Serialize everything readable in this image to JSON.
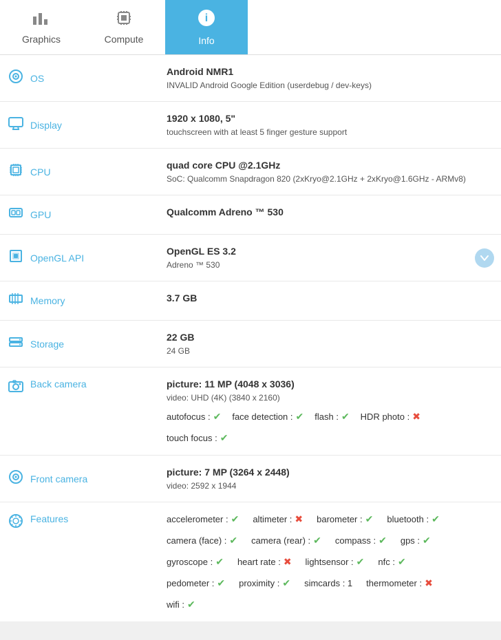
{
  "tabs": [
    {
      "id": "graphics",
      "label": "Graphics",
      "icon": "bar-chart",
      "active": false
    },
    {
      "id": "compute",
      "label": "Compute",
      "icon": "cpu-chip",
      "active": false
    },
    {
      "id": "info",
      "label": "Info",
      "icon": "info-circle",
      "active": true
    }
  ],
  "rows": [
    {
      "id": "os",
      "label": "OS",
      "icon": "os-icon",
      "main": "Android NMR1",
      "sub": "INVALID Android Google Edition (userdebug / dev-keys)"
    },
    {
      "id": "display",
      "label": "Display",
      "icon": "display-icon",
      "main": "1920 x 1080, 5\"",
      "sub": "touchscreen with at least 5 finger gesture support"
    },
    {
      "id": "cpu",
      "label": "CPU",
      "icon": "cpu-icon",
      "main": "quad core CPU @2.1GHz",
      "sub": "SoC: Qualcomm Snapdragon 820 (2xKryo@2.1GHz + 2xKryo@1.6GHz - ARMv8)"
    },
    {
      "id": "gpu",
      "label": "GPU",
      "icon": "gpu-icon",
      "main": "Qualcomm Adreno ™ 530",
      "sub": ""
    },
    {
      "id": "opengl",
      "label": "OpenGL API",
      "icon": "opengl-icon",
      "main": "OpenGL ES 3.2",
      "sub": "Adreno ™ 530",
      "hasDropdown": true
    },
    {
      "id": "memory",
      "label": "Memory",
      "icon": "memory-icon",
      "main": "3.7 GB",
      "sub": ""
    },
    {
      "id": "storage",
      "label": "Storage",
      "icon": "storage-icon",
      "main": "22 GB",
      "sub2": "24 GB"
    },
    {
      "id": "back-camera",
      "label": "Back camera",
      "icon": "camera-icon",
      "main": "picture: 11 MP (4048 x 3036)",
      "sub": "video: UHD (4K) (3840 x 2160)",
      "features": [
        {
          "label": "autofocus",
          "value": true
        },
        {
          "label": "face detection",
          "value": true
        },
        {
          "label": "flash",
          "value": true
        },
        {
          "label": "HDR photo",
          "value": false
        }
      ],
      "features2": [
        {
          "label": "touch focus",
          "value": true
        }
      ]
    },
    {
      "id": "front-camera",
      "label": "Front camera",
      "icon": "front-camera-icon",
      "main": "picture: 7 MP (3264 x 2448)",
      "sub": "video: 2592 x 1944"
    },
    {
      "id": "features",
      "label": "Features",
      "icon": "features-icon",
      "featureGroups": [
        [
          {
            "label": "accelerometer",
            "value": true
          },
          {
            "label": "altimeter",
            "value": false
          },
          {
            "label": "barometer",
            "value": true
          },
          {
            "label": "bluetooth",
            "value": true
          }
        ],
        [
          {
            "label": "camera (face)",
            "value": true
          },
          {
            "label": "camera (rear)",
            "value": true
          },
          {
            "label": "compass",
            "value": true
          },
          {
            "label": "gps",
            "value": true
          }
        ],
        [
          {
            "label": "gyroscope",
            "value": true
          },
          {
            "label": "heart rate",
            "value": false
          },
          {
            "label": "lightsensor",
            "value": true
          },
          {
            "label": "nfc",
            "value": true
          }
        ],
        [
          {
            "label": "pedometer",
            "value": true
          },
          {
            "label": "proximity",
            "value": true
          },
          {
            "label": "simcards",
            "value": "1"
          },
          {
            "label": "thermometer",
            "value": false
          }
        ],
        [
          {
            "label": "wifi",
            "value": true
          }
        ]
      ]
    }
  ]
}
